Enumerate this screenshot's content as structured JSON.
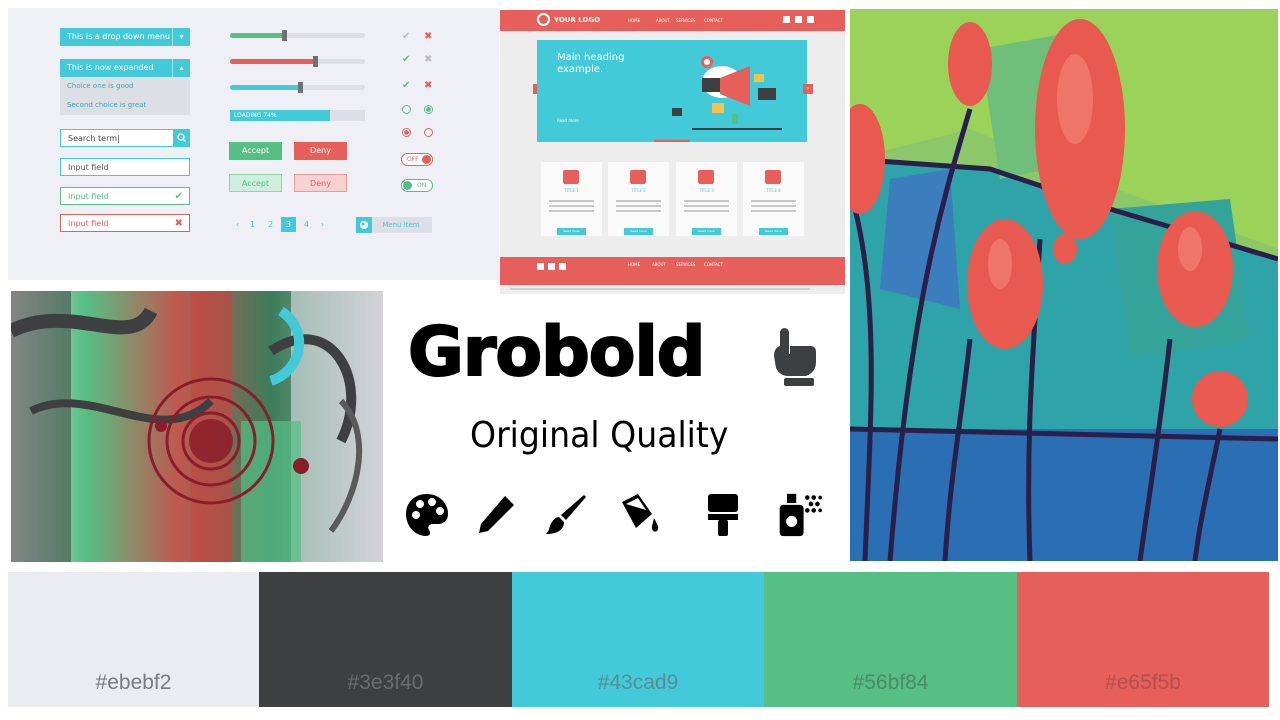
{
  "ui_kit": {
    "dropdown_label": "This is a drop down menu",
    "expanded_label": "This is now expanded",
    "choice_one": "Choice one is good",
    "choice_two": "Second choice is great",
    "search_value": "Search term|",
    "input_plain": "Input field",
    "input_success": "Input field",
    "input_error": "Input field",
    "loading_label": "LOADING 74%",
    "loading_progress": 0.74,
    "slider_levels": [
      0.4,
      0.63,
      0.52
    ],
    "accept_label": "Accept",
    "deny_label": "Deny",
    "pagination": [
      "1",
      "2",
      "3",
      "4"
    ],
    "current_page": "3",
    "menu_item_label": "Menu item",
    "toggle_off_label": "OFF",
    "toggle_on_label": "ON"
  },
  "website": {
    "logo_text": "YOUR LOGO",
    "nav_links": [
      "HOME",
      "ABOUT",
      "SERVICES",
      "CONTACT"
    ],
    "hero_heading": "Main heading example.",
    "hero_link": "Read more",
    "cards": [
      {
        "title": "TITLE 1",
        "button": "Read more"
      },
      {
        "title": "TITLE 2",
        "button": "Read more"
      },
      {
        "title": "TITLE 3",
        "button": "Read more"
      },
      {
        "title": "TITLE 4",
        "button": "Read more"
      }
    ],
    "footer_links": [
      "HOME",
      "ABOUT",
      "SERVICES",
      "CONTACT"
    ]
  },
  "title": "Grobold",
  "subtitle": "Original Quality",
  "tool_icons": [
    "pointer-hand-icon",
    "palette-icon",
    "pencil-icon",
    "brush-icon",
    "paint-bucket-icon",
    "paint-roller-brush-icon",
    "spray-can-icon"
  ],
  "palette": [
    {
      "hex": "#ebebf2",
      "text_color": "#7a7a80"
    },
    {
      "hex": "#3e3f40",
      "text_color": "#6a6b6c"
    },
    {
      "hex": "#43cad9",
      "text_color": "#5a8e96"
    },
    {
      "hex": "#56bf84",
      "text_color": "#4e8a66"
    },
    {
      "hex": "#e65f5b",
      "text_color": "#b05250"
    }
  ],
  "palette_labels": [
    "#ebebf2",
    "#3e3f40",
    "#43cad9",
    "#56bf84",
    "#e65f5b"
  ]
}
